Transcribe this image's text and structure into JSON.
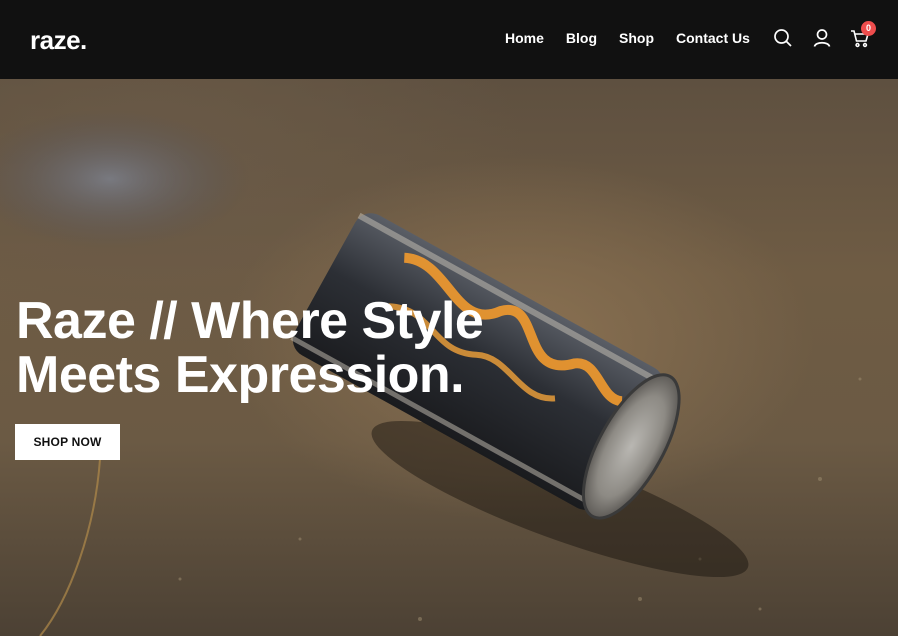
{
  "brand": {
    "logo_text": "raze."
  },
  "nav": {
    "items": [
      "Home",
      "Blog",
      "Shop",
      "Contact Us"
    ]
  },
  "header_icons": {
    "search": "search-icon",
    "account": "user-icon",
    "cart": "cart-icon",
    "cart_count": "0"
  },
  "hero": {
    "title_line1": "Raze // Where Style",
    "title_line2": "Meets Expression.",
    "cta_label": "SHOP NOW"
  },
  "colors": {
    "header_bg": "#111111",
    "badge": "#ee4d4d",
    "cta_bg": "#ffffff"
  }
}
